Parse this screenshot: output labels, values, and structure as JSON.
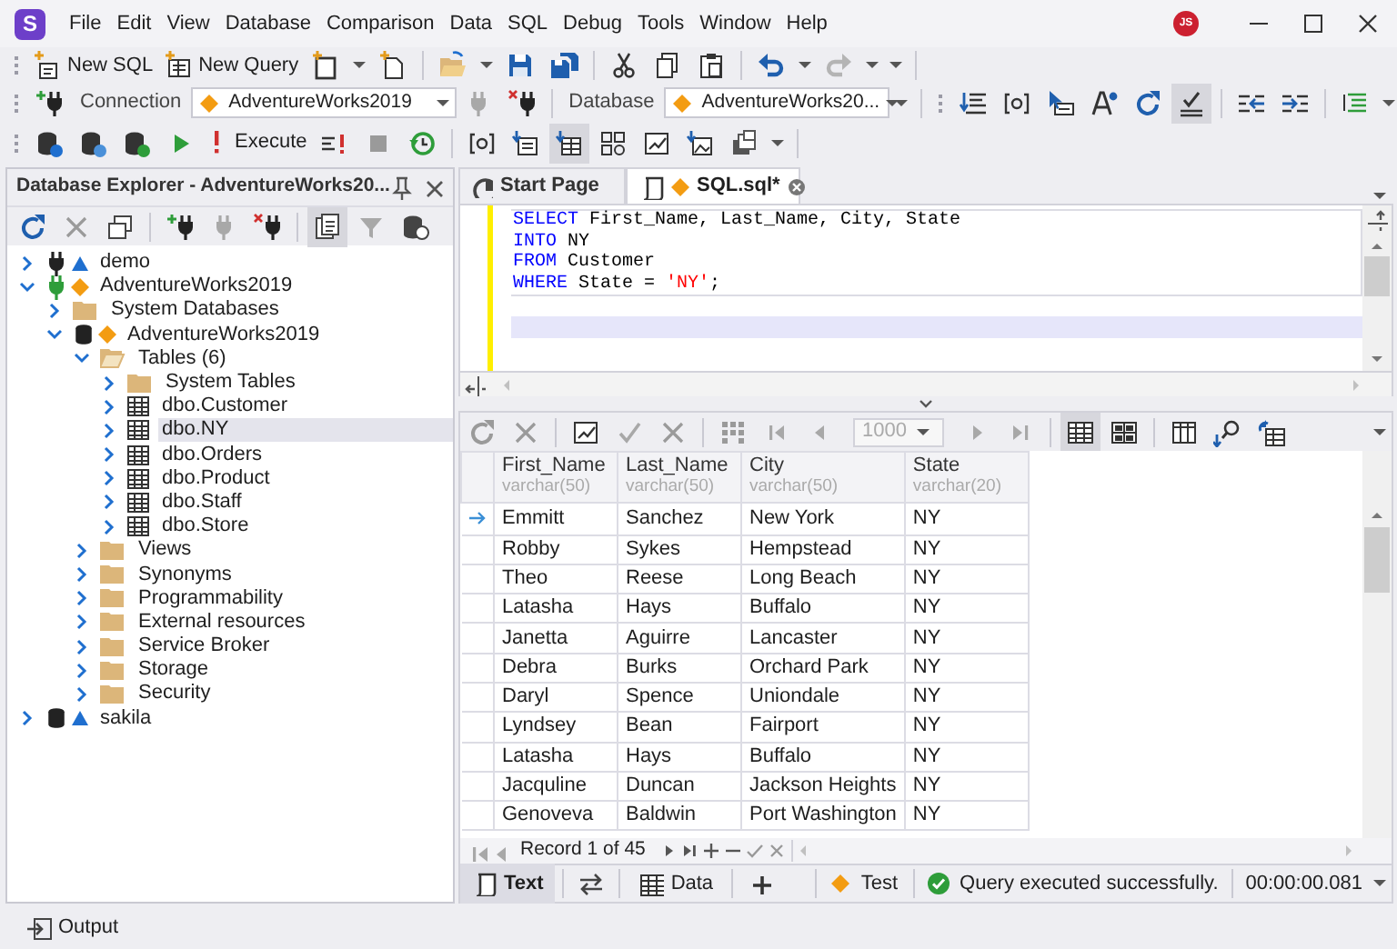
{
  "app": {
    "logo": "S",
    "user_initials": "JS"
  },
  "menu": [
    "File",
    "Edit",
    "View",
    "Database",
    "Comparison",
    "Data",
    "SQL",
    "Debug",
    "Tools",
    "Window",
    "Help"
  ],
  "standard_toolbar": {
    "new_sql": "New SQL",
    "new_query": "New Query"
  },
  "connection_toolbar": {
    "connection_label": "Connection",
    "connection": "AdventureWorks2019",
    "database_label": "Database",
    "database": "AdventureWorks20..."
  },
  "sql_toolbar": {
    "execute": "Execute"
  },
  "explorer": {
    "title": "Database Explorer - AdventureWorks20...",
    "tree": [
      {
        "label": "demo",
        "kind": "mysql_connection",
        "connected": false,
        "expanded": false,
        "selected": false
      },
      {
        "label": "AdventureWorks2019",
        "kind": "sqlserver_connection",
        "connected": true,
        "expanded": true,
        "selected": false,
        "children": [
          {
            "label": "System Databases",
            "kind": "folder",
            "expanded": false,
            "selected": false
          },
          {
            "label": "AdventureWorks2019",
            "kind": "sqlserver_database",
            "expanded": true,
            "selected": false,
            "children": [
              {
                "label": "Tables (6)",
                "kind": "folder",
                "expanded": true,
                "selected": false,
                "children": [
                  {
                    "label": "System Tables",
                    "kind": "folder",
                    "expanded": false,
                    "selected": false
                  },
                  {
                    "label": "dbo.Customer",
                    "kind": "table",
                    "expanded": false,
                    "selected": false
                  },
                  {
                    "label": "dbo.NY",
                    "kind": "table",
                    "expanded": false,
                    "selected": true
                  },
                  {
                    "label": "dbo.Orders",
                    "kind": "table",
                    "expanded": false,
                    "selected": false
                  },
                  {
                    "label": "dbo.Product",
                    "kind": "table",
                    "expanded": false,
                    "selected": false
                  },
                  {
                    "label": "dbo.Staff",
                    "kind": "table",
                    "expanded": false,
                    "selected": false
                  },
                  {
                    "label": "dbo.Store",
                    "kind": "table",
                    "expanded": false,
                    "selected": false
                  }
                ]
              },
              {
                "label": "Views",
                "kind": "folder",
                "expanded": false,
                "selected": false
              },
              {
                "label": "Synonyms",
                "kind": "folder",
                "expanded": false,
                "selected": false
              },
              {
                "label": "Programmability",
                "kind": "folder",
                "expanded": false,
                "selected": false
              },
              {
                "label": "External resources",
                "kind": "folder",
                "expanded": false,
                "selected": false
              },
              {
                "label": "Service Broker",
                "kind": "folder",
                "expanded": false,
                "selected": false
              },
              {
                "label": "Storage",
                "kind": "folder",
                "expanded": false,
                "selected": false
              },
              {
                "label": "Security",
                "kind": "folder",
                "expanded": false,
                "selected": false
              }
            ]
          }
        ]
      },
      {
        "label": "sakila",
        "kind": "mysql_database",
        "expanded": false,
        "selected": false
      }
    ]
  },
  "tabs": [
    {
      "label": "Start Page",
      "kind": "start",
      "selected": false
    },
    {
      "label": "SQL.sql*",
      "kind": "sql",
      "selected": true
    }
  ],
  "editor": {
    "lines": [
      [
        {
          "kind": "keyword",
          "text": "SELECT"
        },
        {
          "kind": "plain",
          "text": " First_Name, Last_Name, City, State"
        }
      ],
      [
        {
          "kind": "keyword",
          "text": "INTO"
        },
        {
          "kind": "plain",
          "text": " NY"
        }
      ],
      [
        {
          "kind": "keyword",
          "text": "FROM"
        },
        {
          "kind": "plain",
          "text": " Customer"
        }
      ],
      [
        {
          "kind": "keyword",
          "text": "WHERE"
        },
        {
          "kind": "plain",
          "text": " State = "
        },
        {
          "kind": "string",
          "text": "'NY'"
        },
        {
          "kind": "plain",
          "text": ";"
        }
      ]
    ]
  },
  "grid": {
    "page_size": "1000",
    "columns": [
      {
        "name": "First_Name",
        "type": "varchar(50)"
      },
      {
        "name": "Last_Name",
        "type": "varchar(50)"
      },
      {
        "name": "City",
        "type": "varchar(50)"
      },
      {
        "name": "State",
        "type": "varchar(20)"
      }
    ],
    "rows": [
      {
        "current": true,
        "cells": [
          "Emmitt",
          "Sanchez",
          "New York",
          "NY"
        ]
      },
      {
        "current": false,
        "cells": [
          "Robby",
          "Sykes",
          "Hempstead",
          "NY"
        ]
      },
      {
        "current": false,
        "cells": [
          "Theo",
          "Reese",
          "Long Beach",
          "NY"
        ]
      },
      {
        "current": false,
        "cells": [
          "Latasha",
          "Hays",
          "Buffalo",
          "NY"
        ]
      },
      {
        "current": false,
        "cells": [
          "Janetta",
          "Aguirre",
          "Lancaster",
          "NY"
        ]
      },
      {
        "current": false,
        "cells": [
          "Debra",
          "Burks",
          "Orchard Park",
          "NY"
        ]
      },
      {
        "current": false,
        "cells": [
          "Daryl",
          "Spence",
          "Uniondale",
          "NY"
        ]
      },
      {
        "current": false,
        "cells": [
          "Lyndsey",
          "Bean",
          "Fairport",
          "NY"
        ]
      },
      {
        "current": false,
        "cells": [
          "Latasha",
          "Hays",
          "Buffalo",
          "NY"
        ]
      },
      {
        "current": false,
        "cells": [
          "Jacquline",
          "Duncan",
          "Jackson Heights",
          "NY"
        ]
      },
      {
        "current": false,
        "cells": [
          "Genoveva",
          "Baldwin",
          "Port Washington",
          "NY"
        ]
      }
    ],
    "record_position": "Record 1 of 45"
  },
  "result_tabs": [
    {
      "label": "Text",
      "kind": "text",
      "selected": true
    },
    {
      "label": "Data",
      "kind": "data",
      "selected": false
    }
  ],
  "status": {
    "connection": "Test",
    "message": "Query executed successfully.",
    "success": true,
    "elapsed": "00:00:00.081"
  },
  "bottom_bar": {
    "output": "Output"
  }
}
